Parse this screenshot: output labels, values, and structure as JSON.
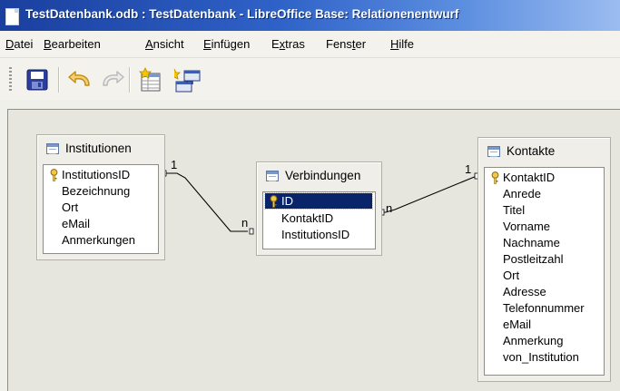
{
  "window": {
    "title": "TestDatenbank.odb : TestDatenbank - LibreOffice Base: Relationenentwurf"
  },
  "menu": [
    {
      "label": "Datei",
      "u": "D",
      "rest": "atei"
    },
    {
      "label": "Bearbeiten",
      "u": "B",
      "rest": "earbeiten"
    },
    {
      "label": "Ansicht",
      "u": "A",
      "rest": "nsicht"
    },
    {
      "label": "Einfügen",
      "u": "E",
      "rest": "infügen"
    },
    {
      "label": "Extras",
      "pre": "E",
      "u": "x",
      "rest": "tras"
    },
    {
      "label": "Fenster",
      "pre": "Fens",
      "u": "t",
      "rest": "er"
    },
    {
      "label": "Hilfe",
      "u": "H",
      "rest": "ilfe"
    }
  ],
  "toolbar": {
    "buttons": [
      "save-icon",
      "undo-icon",
      "redo-icon",
      "new-table-icon",
      "new-relation-icon"
    ]
  },
  "tables": {
    "institutionen": {
      "name": "Institutionen",
      "fields": [
        "InstitutionsID",
        "Bezeichnung",
        "Ort",
        "eMail",
        "Anmerkungen"
      ],
      "primary_key": "InstitutionsID"
    },
    "verbindungen": {
      "name": "Verbindungen",
      "fields": [
        "ID",
        "KontaktID",
        "InstitutionsID"
      ],
      "primary_key": "ID",
      "selected_field": "ID"
    },
    "kontakte": {
      "name": "Kontakte",
      "fields": [
        "KontaktID",
        "Anrede",
        "Titel",
        "Vorname",
        "Nachname",
        "Postleitzahl",
        "Ort",
        "Adresse",
        "Telefonnummer",
        "eMail",
        "Anmerkung",
        "von_Institution"
      ],
      "primary_key": "KontaktID"
    }
  },
  "relations": [
    {
      "from": "Institutionen",
      "to": "Verbindungen",
      "from_card": "1",
      "to_card": "n"
    },
    {
      "from": "Kontakte",
      "to": "Verbindungen",
      "from_card": "1",
      "to_card": "n"
    }
  ],
  "colors": {
    "title_bar": "#2f62c8",
    "selection": "#0a246a",
    "canvas": "#e6e5de"
  }
}
